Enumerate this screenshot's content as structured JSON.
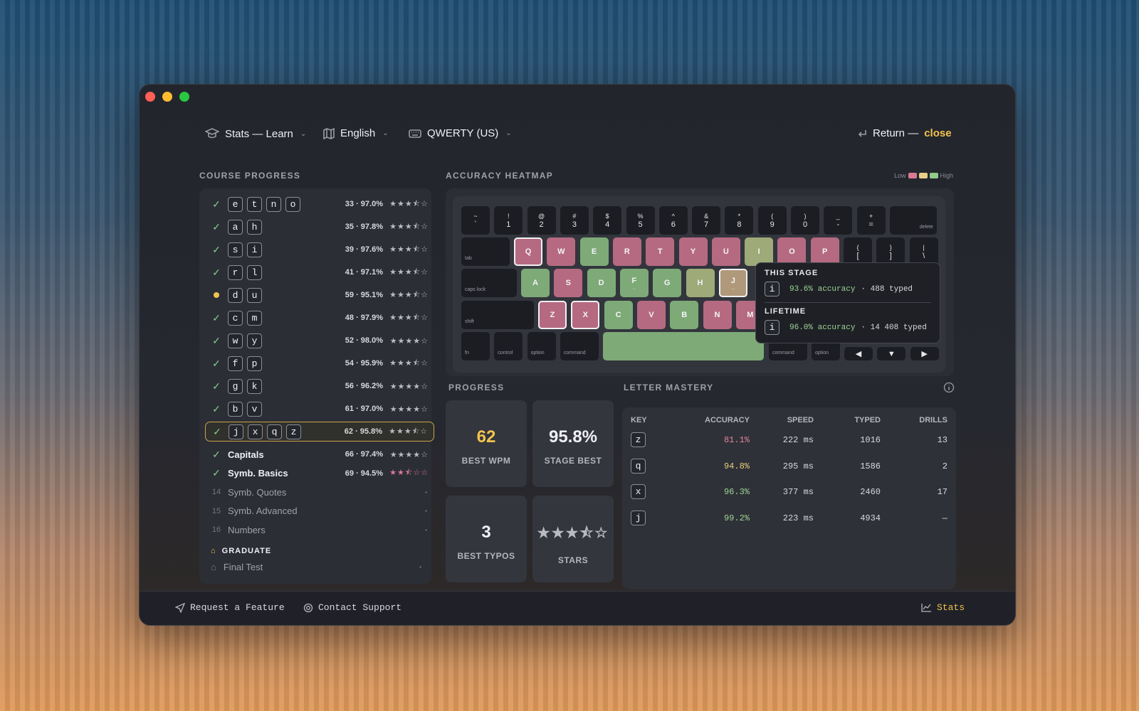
{
  "header": {
    "mode": "Stats — Learn",
    "language": "English",
    "layout": "QWERTY (US)",
    "return_label": "Return —",
    "close_label": "close"
  },
  "course": {
    "title": "COURSE PROGRESS",
    "rows": [
      {
        "status": "done",
        "keys": [
          "e",
          "t",
          "n",
          "o"
        ],
        "score": "33 · 97.0%",
        "stars": "★★★⯪☆"
      },
      {
        "status": "done",
        "keys": [
          "a",
          "h"
        ],
        "score": "35 · 97.8%",
        "stars": "★★★⯪☆"
      },
      {
        "status": "done",
        "keys": [
          "s",
          "i"
        ],
        "score": "39 · 97.6%",
        "stars": "★★★⯪☆"
      },
      {
        "status": "done",
        "keys": [
          "r",
          "l"
        ],
        "score": "41 · 97.1%",
        "stars": "★★★⯪☆"
      },
      {
        "status": "current",
        "keys": [
          "d",
          "u"
        ],
        "score": "59 · 95.1%",
        "stars": "★★★⯪☆"
      },
      {
        "status": "done",
        "keys": [
          "c",
          "m"
        ],
        "score": "48 · 97.9%",
        "stars": "★★★⯪☆"
      },
      {
        "status": "done",
        "keys": [
          "w",
          "y"
        ],
        "score": "52 · 98.0%",
        "stars": "★★★★☆"
      },
      {
        "status": "done",
        "keys": [
          "f",
          "p"
        ],
        "score": "54 · 95.9%",
        "stars": "★★★⯪☆"
      },
      {
        "status": "done",
        "keys": [
          "g",
          "k"
        ],
        "score": "56 · 96.2%",
        "stars": "★★★★☆"
      },
      {
        "status": "done",
        "keys": [
          "b",
          "v"
        ],
        "score": "61 · 97.0%",
        "stars": "★★★★☆"
      },
      {
        "status": "done",
        "keys": [
          "j",
          "x",
          "q",
          "z"
        ],
        "score": "62 · 95.8%",
        "stars": "★★★⯪☆",
        "selected": true
      },
      {
        "status": "done",
        "label": "Capitals",
        "score": "66 · 97.4%",
        "stars": "★★★★☆"
      },
      {
        "status": "done",
        "label": "Symb. Basics",
        "score": "69 · 94.5%",
        "stars": "★★⯪☆☆"
      },
      {
        "status": "locked",
        "num": "14",
        "label": "Symb. Quotes"
      },
      {
        "status": "locked",
        "num": "15",
        "label": "Symb. Advanced"
      },
      {
        "status": "locked",
        "num": "16",
        "label": "Numbers"
      }
    ],
    "graduate_label": "GRADUATE",
    "final_test": "Final Test"
  },
  "heatmap": {
    "title": "ACCURACY HEATMAP",
    "legend_low": "Low",
    "legend_high": "High",
    "legend_colors": [
      "#d97a95",
      "#e8d08a",
      "#8fcb8a"
    ]
  },
  "keyboard": {
    "num_row": [
      [
        "~",
        "`"
      ],
      [
        "!",
        "1"
      ],
      [
        "@",
        "2"
      ],
      [
        "#",
        "3"
      ],
      [
        "$",
        "4"
      ],
      [
        "%",
        "5"
      ],
      [
        "^",
        "6"
      ],
      [
        "&",
        "7"
      ],
      [
        "*",
        "8"
      ],
      [
        "(",
        "9"
      ],
      [
        ")",
        "0"
      ],
      [
        "_",
        "-"
      ],
      [
        "+",
        "="
      ]
    ],
    "delete": "delete",
    "tab": "tab",
    "caps": "caps lock",
    "shift": "shift",
    "fn": "fn",
    "control": "control",
    "option": "option",
    "command": "command",
    "brackets": [
      [
        "{",
        "["
      ],
      [
        "}",
        "]"
      ],
      [
        "|",
        "\\"
      ]
    ],
    "arrows": [
      "◀",
      "▼",
      "▶"
    ],
    "q_row": [
      {
        "k": "Q",
        "c": "red",
        "sel": true
      },
      {
        "k": "W",
        "c": "red"
      },
      {
        "k": "E",
        "c": "green"
      },
      {
        "k": "R",
        "c": "red"
      },
      {
        "k": "T",
        "c": "red"
      },
      {
        "k": "Y",
        "c": "red"
      },
      {
        "k": "U",
        "c": "red"
      },
      {
        "k": "I",
        "c": "olive"
      },
      {
        "k": "O",
        "c": "red"
      },
      {
        "k": "P",
        "c": "red"
      }
    ],
    "a_row": [
      {
        "k": "A",
        "c": "green"
      },
      {
        "k": "S",
        "c": "red"
      },
      {
        "k": "D",
        "c": "green"
      },
      {
        "k": "F",
        "c": "green",
        "bump": "_"
      },
      {
        "k": "G",
        "c": "green"
      },
      {
        "k": "H",
        "c": "olive"
      },
      {
        "k": "J",
        "c": "tan",
        "sel": true,
        "bump": "_"
      }
    ],
    "z_row": [
      {
        "k": "Z",
        "c": "red",
        "sel": true
      },
      {
        "k": "X",
        "c": "red",
        "sel": true
      },
      {
        "k": "C",
        "c": "green"
      },
      {
        "k": "V",
        "c": "red"
      },
      {
        "k": "B",
        "c": "green"
      },
      {
        "k": "N",
        "c": "red"
      },
      {
        "k": "M",
        "c": "red"
      }
    ]
  },
  "tooltip": {
    "stage_title": "THIS STAGE",
    "stage_key": "i",
    "stage_acc": "93.6% accuracy",
    "stage_typed": "· 488 typed",
    "life_title": "LIFETIME",
    "life_key": "i",
    "life_acc": "96.0% accuracy",
    "life_typed": "· 14 408 typed"
  },
  "progress": {
    "title": "PROGRESS",
    "wpm": "62",
    "wpm_label": "BEST WPM",
    "stage": "95.8%",
    "stage_label": "STAGE BEST",
    "typos": "3",
    "typos_label": "BEST TYPOS",
    "stars": "★★★⯪☆",
    "stars_label": "STARS"
  },
  "mastery": {
    "title": "LETTER MASTERY",
    "headers": [
      "KEY",
      "ACCURACY",
      "SPEED",
      "TYPED",
      "DRILLS"
    ],
    "rows": [
      {
        "key": "z",
        "acc": "81.1%",
        "acc_color": "#e2839c",
        "speed": "222 ms",
        "typed": "1016",
        "drills": "13"
      },
      {
        "key": "q",
        "acc": "94.8%",
        "acc_color": "#e8cf7e",
        "speed": "295 ms",
        "typed": "1586",
        "drills": "2"
      },
      {
        "key": "x",
        "acc": "96.3%",
        "acc_color": "#9ed594",
        "speed": "377 ms",
        "typed": "2460",
        "drills": "17"
      },
      {
        "key": "j",
        "acc": "99.2%",
        "acc_color": "#9ed594",
        "speed": "223 ms",
        "typed": "4934",
        "drills": "—"
      }
    ]
  },
  "footer": {
    "feature": "Request a Feature",
    "support": "Contact Support",
    "stats": "Stats"
  }
}
